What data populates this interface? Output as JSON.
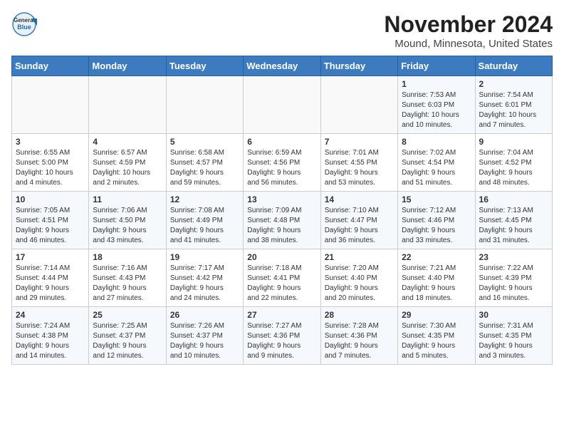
{
  "logo": {
    "general": "General",
    "blue": "Blue"
  },
  "title": "November 2024",
  "subtitle": "Mound, Minnesota, United States",
  "days_of_week": [
    "Sunday",
    "Monday",
    "Tuesday",
    "Wednesday",
    "Thursday",
    "Friday",
    "Saturday"
  ],
  "weeks": [
    [
      {
        "day": "",
        "info": ""
      },
      {
        "day": "",
        "info": ""
      },
      {
        "day": "",
        "info": ""
      },
      {
        "day": "",
        "info": ""
      },
      {
        "day": "",
        "info": ""
      },
      {
        "day": "1",
        "info": "Sunrise: 7:53 AM\nSunset: 6:03 PM\nDaylight: 10 hours\nand 10 minutes."
      },
      {
        "day": "2",
        "info": "Sunrise: 7:54 AM\nSunset: 6:01 PM\nDaylight: 10 hours\nand 7 minutes."
      }
    ],
    [
      {
        "day": "3",
        "info": "Sunrise: 6:55 AM\nSunset: 5:00 PM\nDaylight: 10 hours\nand 4 minutes."
      },
      {
        "day": "4",
        "info": "Sunrise: 6:57 AM\nSunset: 4:59 PM\nDaylight: 10 hours\nand 2 minutes."
      },
      {
        "day": "5",
        "info": "Sunrise: 6:58 AM\nSunset: 4:57 PM\nDaylight: 9 hours\nand 59 minutes."
      },
      {
        "day": "6",
        "info": "Sunrise: 6:59 AM\nSunset: 4:56 PM\nDaylight: 9 hours\nand 56 minutes."
      },
      {
        "day": "7",
        "info": "Sunrise: 7:01 AM\nSunset: 4:55 PM\nDaylight: 9 hours\nand 53 minutes."
      },
      {
        "day": "8",
        "info": "Sunrise: 7:02 AM\nSunset: 4:54 PM\nDaylight: 9 hours\nand 51 minutes."
      },
      {
        "day": "9",
        "info": "Sunrise: 7:04 AM\nSunset: 4:52 PM\nDaylight: 9 hours\nand 48 minutes."
      }
    ],
    [
      {
        "day": "10",
        "info": "Sunrise: 7:05 AM\nSunset: 4:51 PM\nDaylight: 9 hours\nand 46 minutes."
      },
      {
        "day": "11",
        "info": "Sunrise: 7:06 AM\nSunset: 4:50 PM\nDaylight: 9 hours\nand 43 minutes."
      },
      {
        "day": "12",
        "info": "Sunrise: 7:08 AM\nSunset: 4:49 PM\nDaylight: 9 hours\nand 41 minutes."
      },
      {
        "day": "13",
        "info": "Sunrise: 7:09 AM\nSunset: 4:48 PM\nDaylight: 9 hours\nand 38 minutes."
      },
      {
        "day": "14",
        "info": "Sunrise: 7:10 AM\nSunset: 4:47 PM\nDaylight: 9 hours\nand 36 minutes."
      },
      {
        "day": "15",
        "info": "Sunrise: 7:12 AM\nSunset: 4:46 PM\nDaylight: 9 hours\nand 33 minutes."
      },
      {
        "day": "16",
        "info": "Sunrise: 7:13 AM\nSunset: 4:45 PM\nDaylight: 9 hours\nand 31 minutes."
      }
    ],
    [
      {
        "day": "17",
        "info": "Sunrise: 7:14 AM\nSunset: 4:44 PM\nDaylight: 9 hours\nand 29 minutes."
      },
      {
        "day": "18",
        "info": "Sunrise: 7:16 AM\nSunset: 4:43 PM\nDaylight: 9 hours\nand 27 minutes."
      },
      {
        "day": "19",
        "info": "Sunrise: 7:17 AM\nSunset: 4:42 PM\nDaylight: 9 hours\nand 24 minutes."
      },
      {
        "day": "20",
        "info": "Sunrise: 7:18 AM\nSunset: 4:41 PM\nDaylight: 9 hours\nand 22 minutes."
      },
      {
        "day": "21",
        "info": "Sunrise: 7:20 AM\nSunset: 4:40 PM\nDaylight: 9 hours\nand 20 minutes."
      },
      {
        "day": "22",
        "info": "Sunrise: 7:21 AM\nSunset: 4:40 PM\nDaylight: 9 hours\nand 18 minutes."
      },
      {
        "day": "23",
        "info": "Sunrise: 7:22 AM\nSunset: 4:39 PM\nDaylight: 9 hours\nand 16 minutes."
      }
    ],
    [
      {
        "day": "24",
        "info": "Sunrise: 7:24 AM\nSunset: 4:38 PM\nDaylight: 9 hours\nand 14 minutes."
      },
      {
        "day": "25",
        "info": "Sunrise: 7:25 AM\nSunset: 4:37 PM\nDaylight: 9 hours\nand 12 minutes."
      },
      {
        "day": "26",
        "info": "Sunrise: 7:26 AM\nSunset: 4:37 PM\nDaylight: 9 hours\nand 10 minutes."
      },
      {
        "day": "27",
        "info": "Sunrise: 7:27 AM\nSunset: 4:36 PM\nDaylight: 9 hours\nand 9 minutes."
      },
      {
        "day": "28",
        "info": "Sunrise: 7:28 AM\nSunset: 4:36 PM\nDaylight: 9 hours\nand 7 minutes."
      },
      {
        "day": "29",
        "info": "Sunrise: 7:30 AM\nSunset: 4:35 PM\nDaylight: 9 hours\nand 5 minutes."
      },
      {
        "day": "30",
        "info": "Sunrise: 7:31 AM\nSunset: 4:35 PM\nDaylight: 9 hours\nand 3 minutes."
      }
    ]
  ]
}
